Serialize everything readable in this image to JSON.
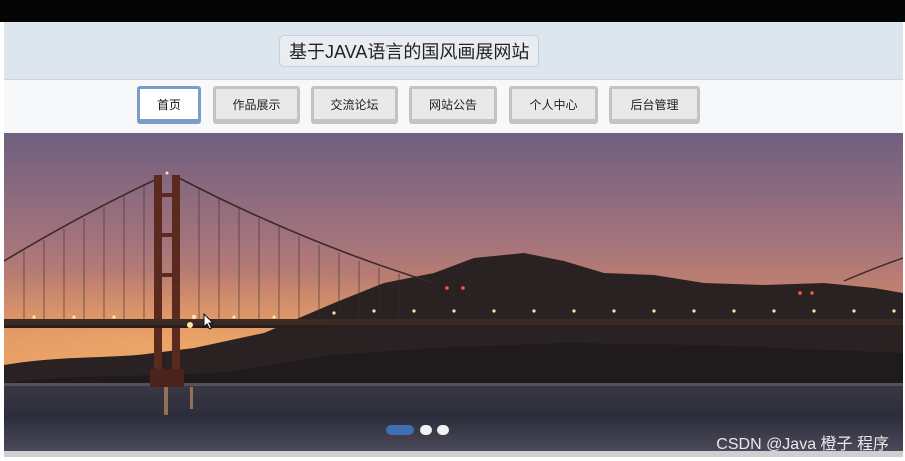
{
  "header": {
    "title": "基于JAVA语言的国风画展网站"
  },
  "nav": {
    "items": [
      {
        "label": "首页",
        "active": true
      },
      {
        "label": "作品展示",
        "active": false
      },
      {
        "label": "交流论坛",
        "active": false
      },
      {
        "label": "网站公告",
        "active": false
      },
      {
        "label": "个人中心",
        "active": false
      },
      {
        "label": "后台管理",
        "active": false
      }
    ]
  },
  "carousel": {
    "slide_count": 3,
    "active_index": 0,
    "image": "golden-gate-bridge-sunset"
  },
  "watermark": "CSDN @Java  橙子  程序",
  "colors": {
    "header_bg": "#dde5ef",
    "nav_active_border": "#7b9cc6",
    "dot_active": "#3f6fb0",
    "dot_inactive": "#f2f2f2"
  },
  "icons": {
    "cursor": "mouse-pointer-icon"
  }
}
